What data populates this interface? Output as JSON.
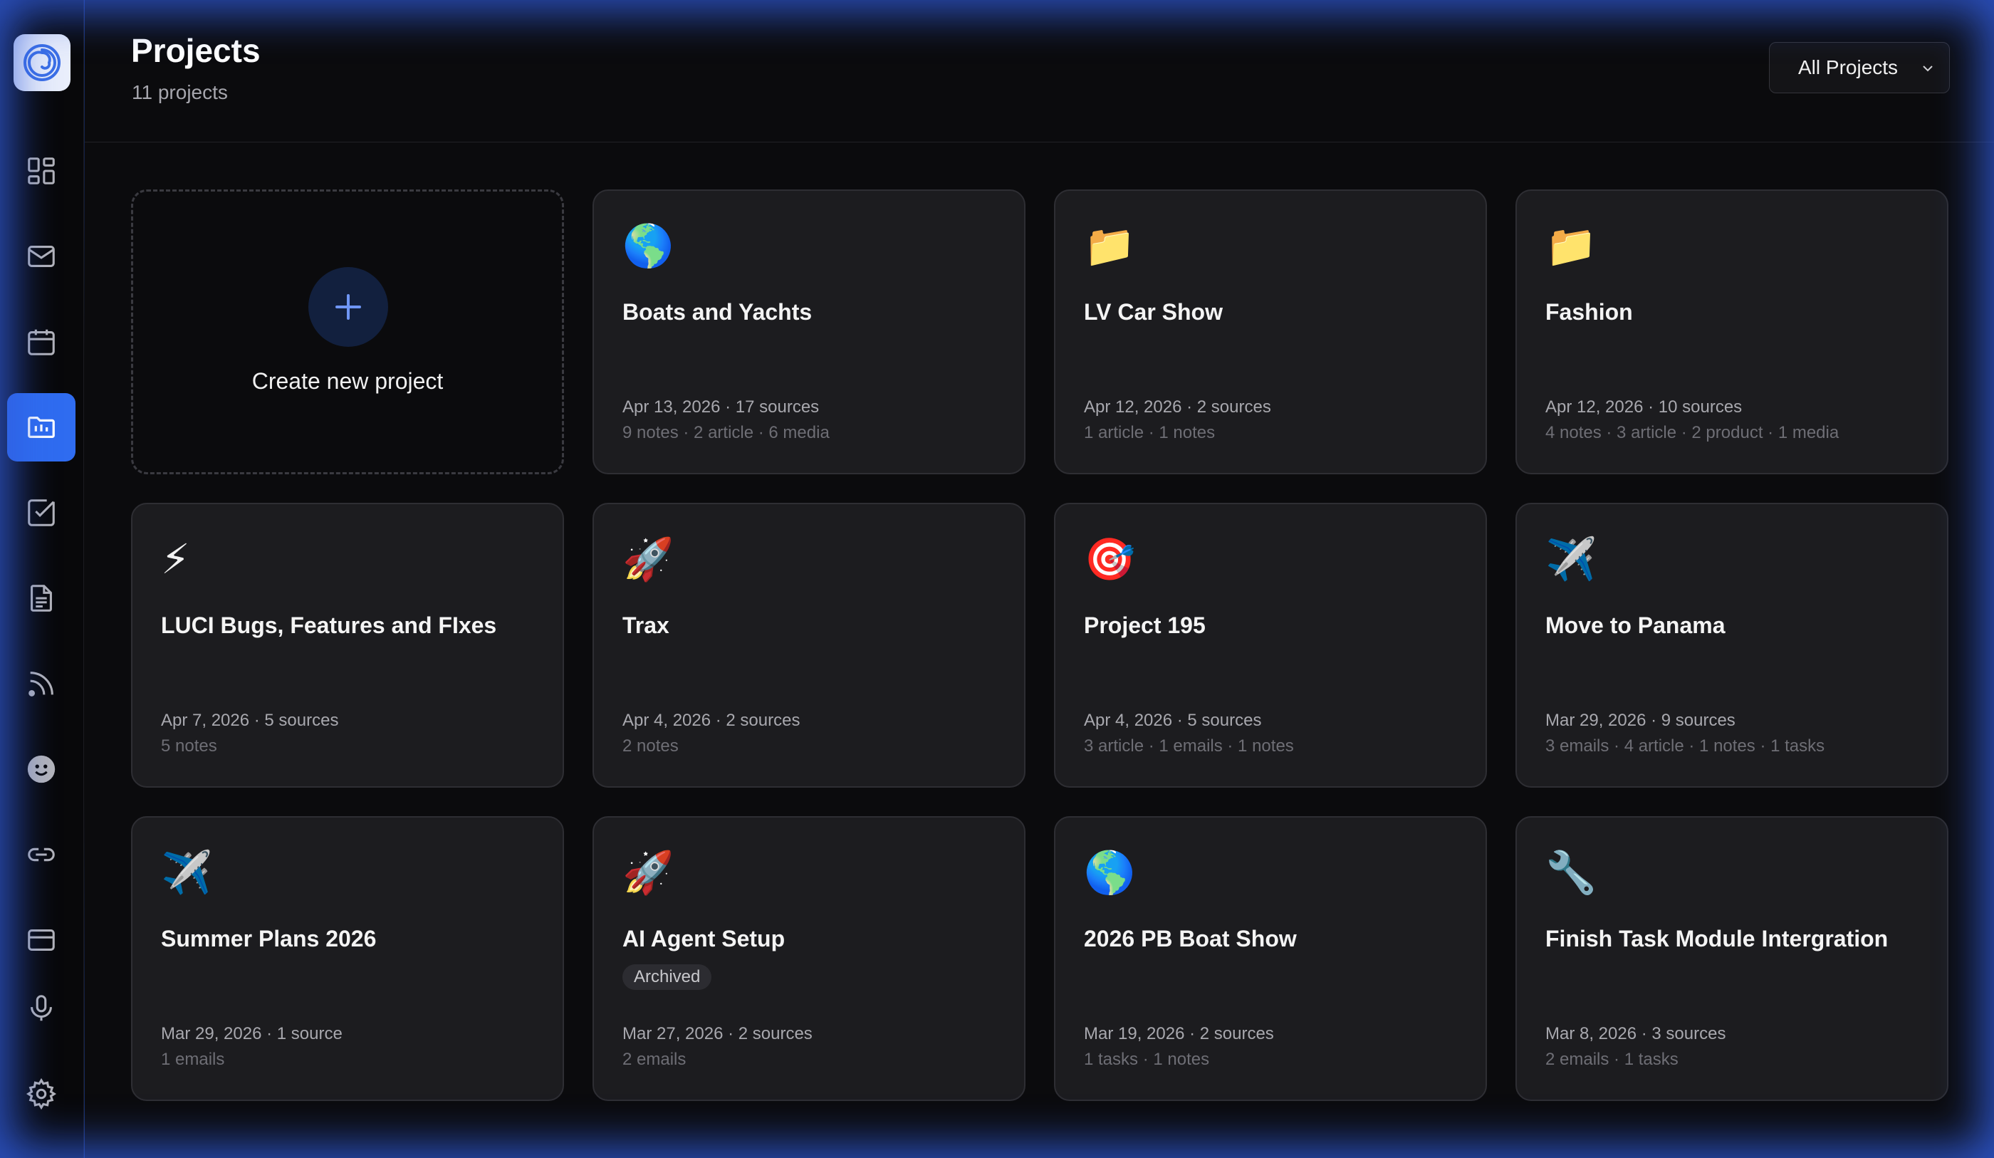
{
  "header": {
    "title": "Projects",
    "subtitle": "11 projects",
    "filter_label": "All Projects"
  },
  "sidebar": {
    "items": [
      {
        "name": "dashboard",
        "icon": "dashboard-grid-icon"
      },
      {
        "name": "mail",
        "icon": "mail-icon"
      },
      {
        "name": "calendar",
        "icon": "calendar-icon"
      },
      {
        "name": "projects",
        "icon": "project-folder-icon",
        "active": true
      },
      {
        "name": "tasks",
        "icon": "checkbox-icon"
      },
      {
        "name": "documents",
        "icon": "document-icon"
      },
      {
        "name": "feeds",
        "icon": "rss-icon"
      },
      {
        "name": "agent",
        "icon": "face-icon"
      },
      {
        "name": "links",
        "icon": "link-icon"
      },
      {
        "name": "billing",
        "icon": "credit-card-icon"
      },
      {
        "name": "voice",
        "icon": "microphone-icon"
      },
      {
        "name": "settings",
        "icon": "gear-icon"
      }
    ]
  },
  "create_card": {
    "label": "Create new project"
  },
  "projects": [
    {
      "icon": "🌎",
      "title": "Boats and Yachts",
      "meta": "Apr 13, 2026 · 17 sources",
      "sub": "9 notes · 2 article · 6 media"
    },
    {
      "icon": "📁",
      "title": "LV Car Show",
      "meta": "Apr 12, 2026 · 2 sources",
      "sub": "1 article · 1 notes"
    },
    {
      "icon": "📁",
      "title": "Fashion",
      "meta": "Apr 12, 2026 · 10 sources",
      "sub": "4 notes · 3 article · 2 product · 1 media"
    },
    {
      "icon": "⚡",
      "title": "LUCI Bugs, Features and FIxes",
      "meta": "Apr 7, 2026 · 5 sources",
      "sub": "5 notes"
    },
    {
      "icon": "🚀",
      "title": "Trax",
      "meta": "Apr 4, 2026 · 2 sources",
      "sub": "2 notes"
    },
    {
      "icon": "🎯",
      "title": "Project 195",
      "meta": "Apr 4, 2026 · 5 sources",
      "sub": "3 article · 1 emails · 1 notes"
    },
    {
      "icon": "✈️",
      "title": "Move to Panama",
      "meta": "Mar 29, 2026 · 9 sources",
      "sub": "3 emails · 4 article · 1 notes · 1 tasks"
    },
    {
      "icon": "✈️",
      "title": "Summer Plans 2026",
      "meta": "Mar 29, 2026 · 1 source",
      "sub": "1 emails"
    },
    {
      "icon": "🚀",
      "title": "AI Agent Setup",
      "badge": "Archived",
      "meta": "Mar 27, 2026 · 2 sources",
      "sub": "2 emails"
    },
    {
      "icon": "🌎",
      "title": "2026 PB Boat Show",
      "meta": "Mar 19, 2026 · 2 sources",
      "sub": "1 tasks · 1 notes"
    },
    {
      "icon": "🔧",
      "title": "Finish Task Module Intergration",
      "meta": "Mar 8, 2026 · 3 sources",
      "sub": "2 emails · 1 tasks"
    }
  ],
  "colors": {
    "accent": "#2f6cf0",
    "card_bg": "#1c1c1f",
    "page_bg": "#0b0b0d"
  }
}
